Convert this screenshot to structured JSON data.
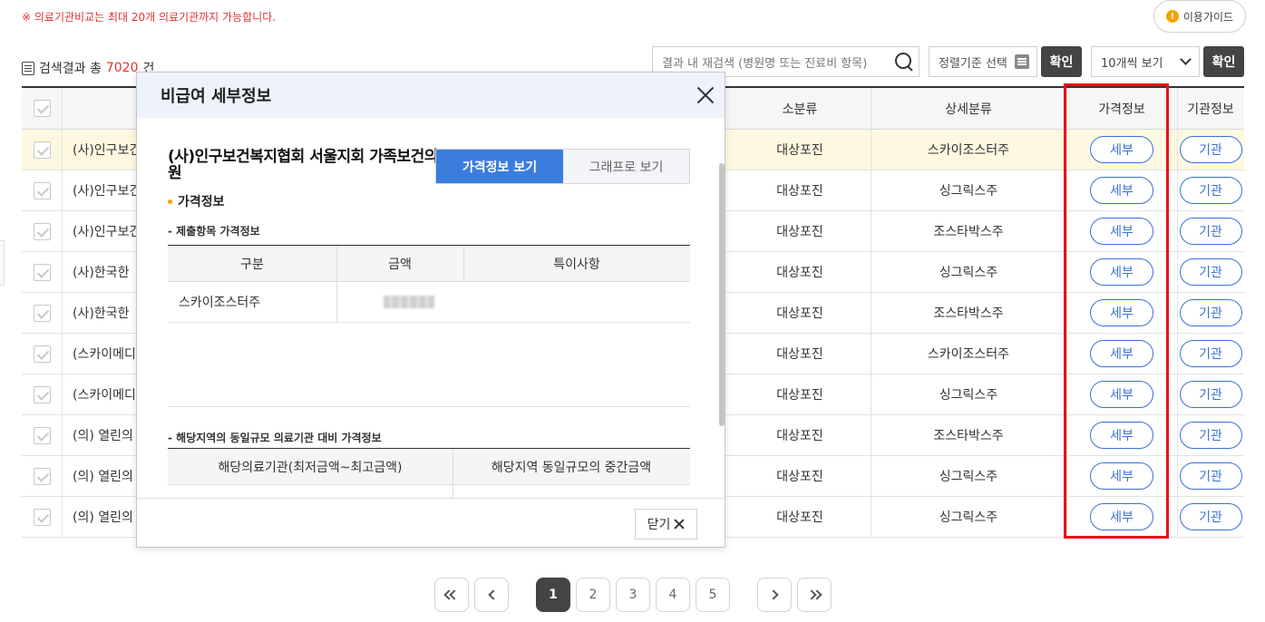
{
  "notice": "※ 의료기관비교는 최대 20개 의료기관까지 가능합니다.",
  "guide": {
    "label": "이용가이드",
    "icon": "warning-icon"
  },
  "result": {
    "prefix": "검색결과 총",
    "count": "7020",
    "suffix": "건"
  },
  "search": {
    "placeholder": "결과 내 재검색 (병원명 또는 진료비 항목)"
  },
  "sort": {
    "label": "정렬기준 선택"
  },
  "confirm_label": "확인",
  "per_page": {
    "selected": "10개씩 보기"
  },
  "columns": {
    "sub": "소분류",
    "detail": "상세분류",
    "price": "가격정보",
    "org": "기관정보"
  },
  "rows": [
    {
      "name": "(사)인구보건",
      "sub": "대상포진",
      "detail": "스카이조스터주",
      "price_btn": "세부",
      "org_btn": "기관"
    },
    {
      "name": "(사)인구보건",
      "sub": "대상포진",
      "detail": "싱그릭스주",
      "price_btn": "세부",
      "org_btn": "기관"
    },
    {
      "name": "(사)인구보건",
      "sub": "대상포진",
      "detail": "조스타박스주",
      "price_btn": "세부",
      "org_btn": "기관"
    },
    {
      "name": "(사)한국한",
      "sub": "대상포진",
      "detail": "싱그릭스주",
      "price_btn": "세부",
      "org_btn": "기관"
    },
    {
      "name": "(사)한국한",
      "sub": "대상포진",
      "detail": "조스타박스주",
      "price_btn": "세부",
      "org_btn": "기관"
    },
    {
      "name": "(스카이메디",
      "sub": "대상포진",
      "detail": "스카이조스터주",
      "price_btn": "세부",
      "org_btn": "기관"
    },
    {
      "name": "(스카이메디",
      "sub": "대상포진",
      "detail": "싱그릭스주",
      "price_btn": "세부",
      "org_btn": "기관"
    },
    {
      "name": "(의) 열린의",
      "sub": "대상포진",
      "detail": "조스타박스주",
      "price_btn": "세부",
      "org_btn": "기관"
    },
    {
      "name": "(의) 열린의",
      "sub": "대상포진",
      "detail": "싱그릭스주",
      "price_btn": "세부",
      "org_btn": "기관"
    },
    {
      "name": "(의) 열린의",
      "sub": "대상포진",
      "detail": "싱그릭스주",
      "price_btn": "세부",
      "org_btn": "기관"
    }
  ],
  "pagination": {
    "pages": [
      "1",
      "2",
      "3",
      "4",
      "5"
    ],
    "current": "1"
  },
  "modal": {
    "title": "비급여 세부정보",
    "org_name": "(사)인구보건복지협회 서울지회 가족보건의원",
    "tab_price": "가격정보 보기",
    "tab_graph": "그래프로 보기",
    "section": "가격정보",
    "sub1": "- 제출항목 가격정보",
    "t1_headers": [
      "구분",
      "금액",
      "특이사항"
    ],
    "t1_row": {
      "item": "스카이조스터주"
    },
    "sub2": "- 해당지역의 동일규모 의료기관 대비 가격정보",
    "t2_headers": [
      "해당의료기관(최저금액~최고금액)",
      "해당지역 동일규모의 중간금액"
    ],
    "close_label": "닫기"
  },
  "colors": {
    "accent": "#3b7ddd",
    "pill": "#3a6fd8",
    "highlight_box": "#e8101a",
    "dark_btn": "#444444",
    "notice": "#e03131"
  }
}
